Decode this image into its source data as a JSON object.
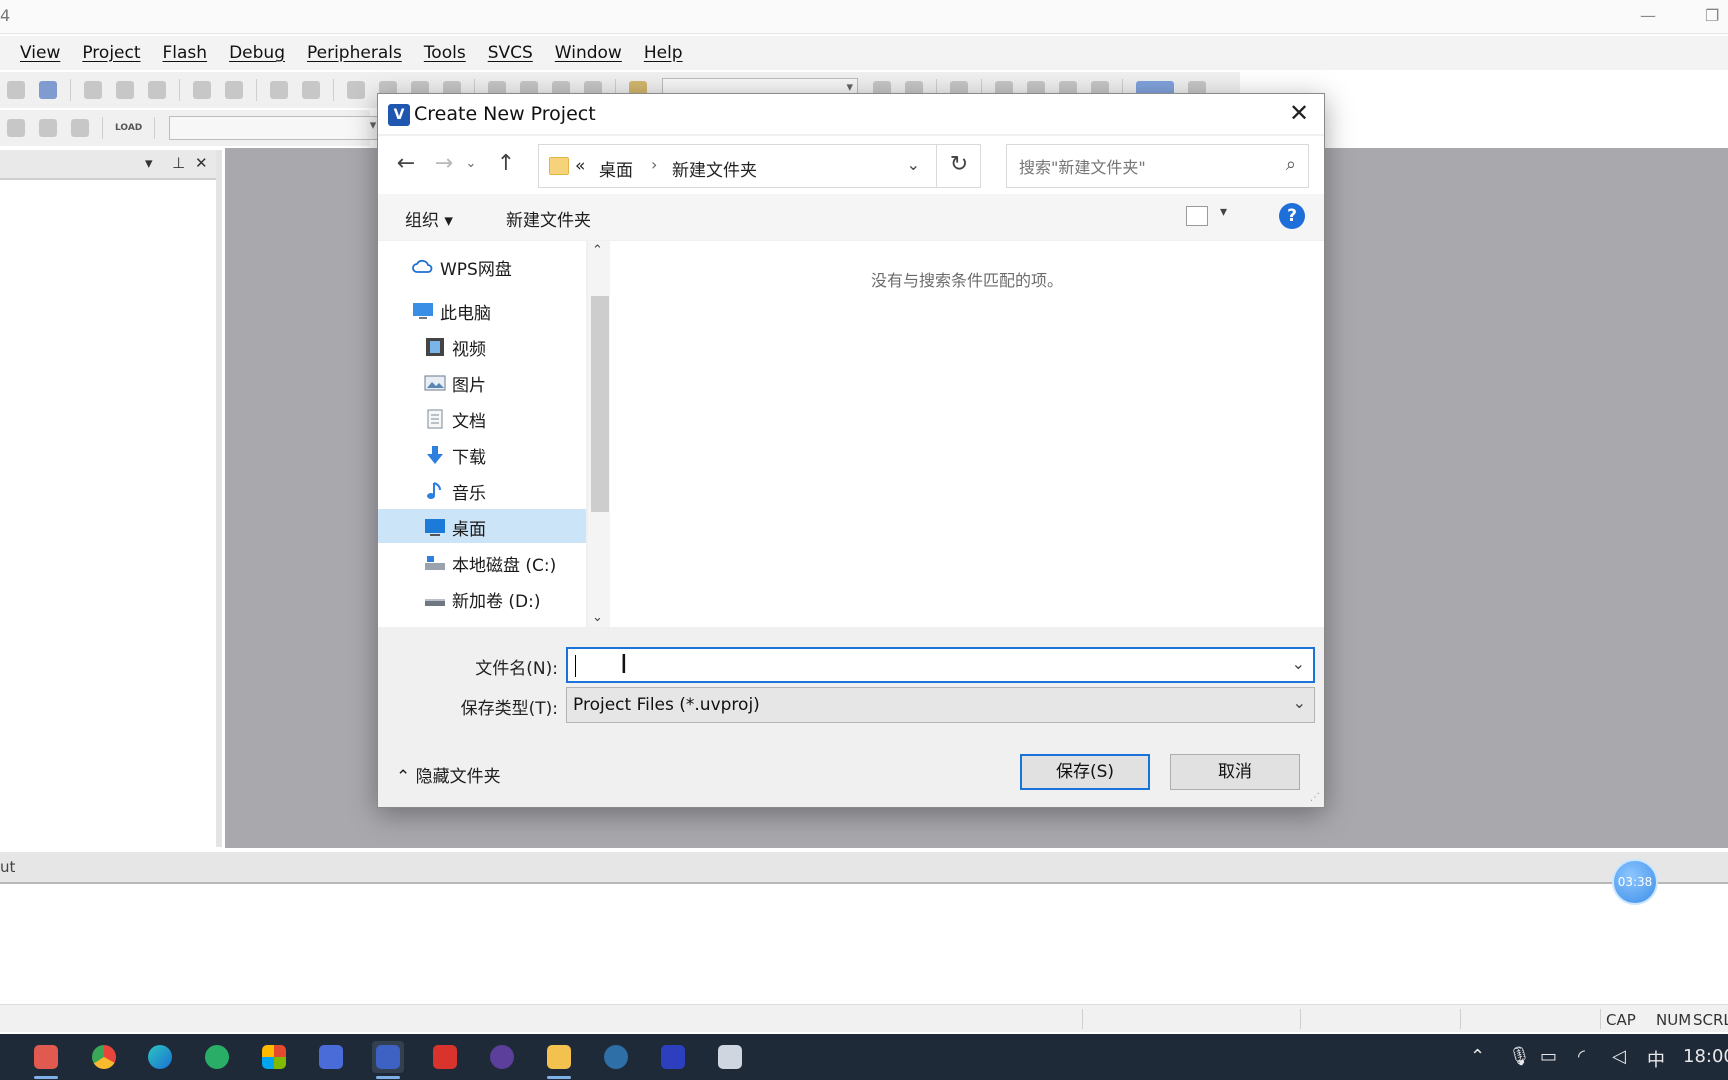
{
  "ide": {
    "title_fragment": "4",
    "menu": [
      "View",
      "Project",
      "Flash",
      "Debug",
      "Peripherals",
      "Tools",
      "SVCS",
      "Window",
      "Help"
    ],
    "toolbar_load_label": "LOAD",
    "output_label": "ut",
    "status": {
      "cap": "CAP",
      "num": "NUM",
      "scrl": "SCRL"
    },
    "timer": "03:38"
  },
  "dialog": {
    "title": "Create New Project",
    "close_label": "✕",
    "breadcrumb": {
      "prefix": "«",
      "parts": [
        "桌面",
        "新建文件夹"
      ]
    },
    "search_placeholder": "搜索\"新建文件夹\"",
    "organize_label": "组织 ▾",
    "new_folder_label": "新建文件夹",
    "help_label": "?",
    "nav_items": [
      {
        "label": "WPS网盘",
        "icon": "cloud-icon"
      },
      {
        "label": "此电脑",
        "icon": "computer-icon"
      },
      {
        "label": "视频",
        "icon": "video-icon"
      },
      {
        "label": "图片",
        "icon": "picture-icon"
      },
      {
        "label": "文档",
        "icon": "document-icon"
      },
      {
        "label": "下载",
        "icon": "download-icon"
      },
      {
        "label": "音乐",
        "icon": "music-icon"
      },
      {
        "label": "桌面",
        "icon": "desktop-icon",
        "selected": true
      },
      {
        "label": "本地磁盘 (C:)",
        "icon": "drive-icon"
      },
      {
        "label": "新加卷 (D:)",
        "icon": "drive-icon"
      }
    ],
    "empty_message": "没有与搜索条件匹配的项。",
    "filename_label": "文件名(N):",
    "filename_value": "",
    "filetype_label": "保存类型(T):",
    "filetype_value": "Project Files (*.uvproj)",
    "hide_folders_label": "隐藏文件夹",
    "save_label": "保存(S)",
    "cancel_label": "取消"
  },
  "taskbar": {
    "apps": [
      "paint-icon",
      "chrome-icon",
      "edge-icon",
      "wechat-icon",
      "office-icon",
      "wps-icon",
      "keil-icon",
      "acrobat-icon",
      "eclipse-icon",
      "file-explorer-icon",
      "arduino-icon",
      "isis-icon",
      "tools-icon"
    ],
    "active_app": "keil-icon",
    "ime": "中",
    "clock": "18:00",
    "colors": {
      "accent": "#1a73d9",
      "taskbar": "#1f2a38"
    }
  }
}
